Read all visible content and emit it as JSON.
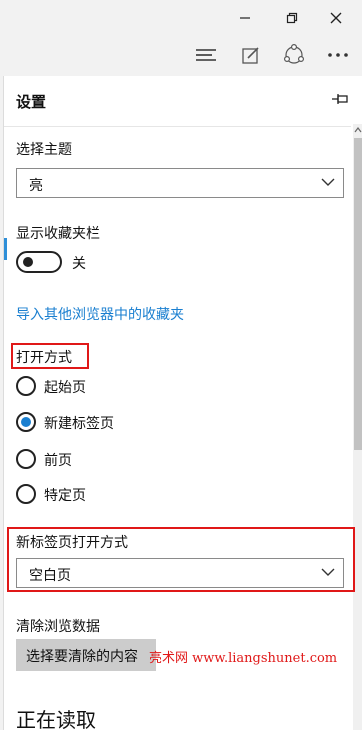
{
  "window": {
    "minimize_icon": "minimize-icon",
    "maximize_icon": "restore-icon",
    "close_icon": "close-icon"
  },
  "toolbar": {
    "icons": [
      "hub-icon",
      "web-note-icon",
      "share-icon",
      "more-icon"
    ]
  },
  "settings": {
    "title": "设置",
    "pin_icon": "pin-icon",
    "theme": {
      "label": "选择主题",
      "value": "亮"
    },
    "favorites_bar": {
      "label": "显示收藏夹栏",
      "state_label": "关",
      "on": false
    },
    "import_link": "导入其他浏览器中的收藏夹",
    "open_with": {
      "label": "打开方式",
      "options": [
        {
          "label": "起始页",
          "selected": false
        },
        {
          "label": "新建标签页",
          "selected": true
        },
        {
          "label": "前页",
          "selected": false
        },
        {
          "label": "特定页",
          "selected": false
        }
      ]
    },
    "new_tab": {
      "label": "新标签页打开方式",
      "value": "空白页"
    },
    "clear_data": {
      "label": "清除浏览数据",
      "button": "选择要清除的内容"
    },
    "reading": {
      "label": "正在读取"
    }
  },
  "watermark": "亮术网 www.liangshunet.com",
  "colors": {
    "accent": "#1a7fd0",
    "highlight_box": "#e01818"
  }
}
